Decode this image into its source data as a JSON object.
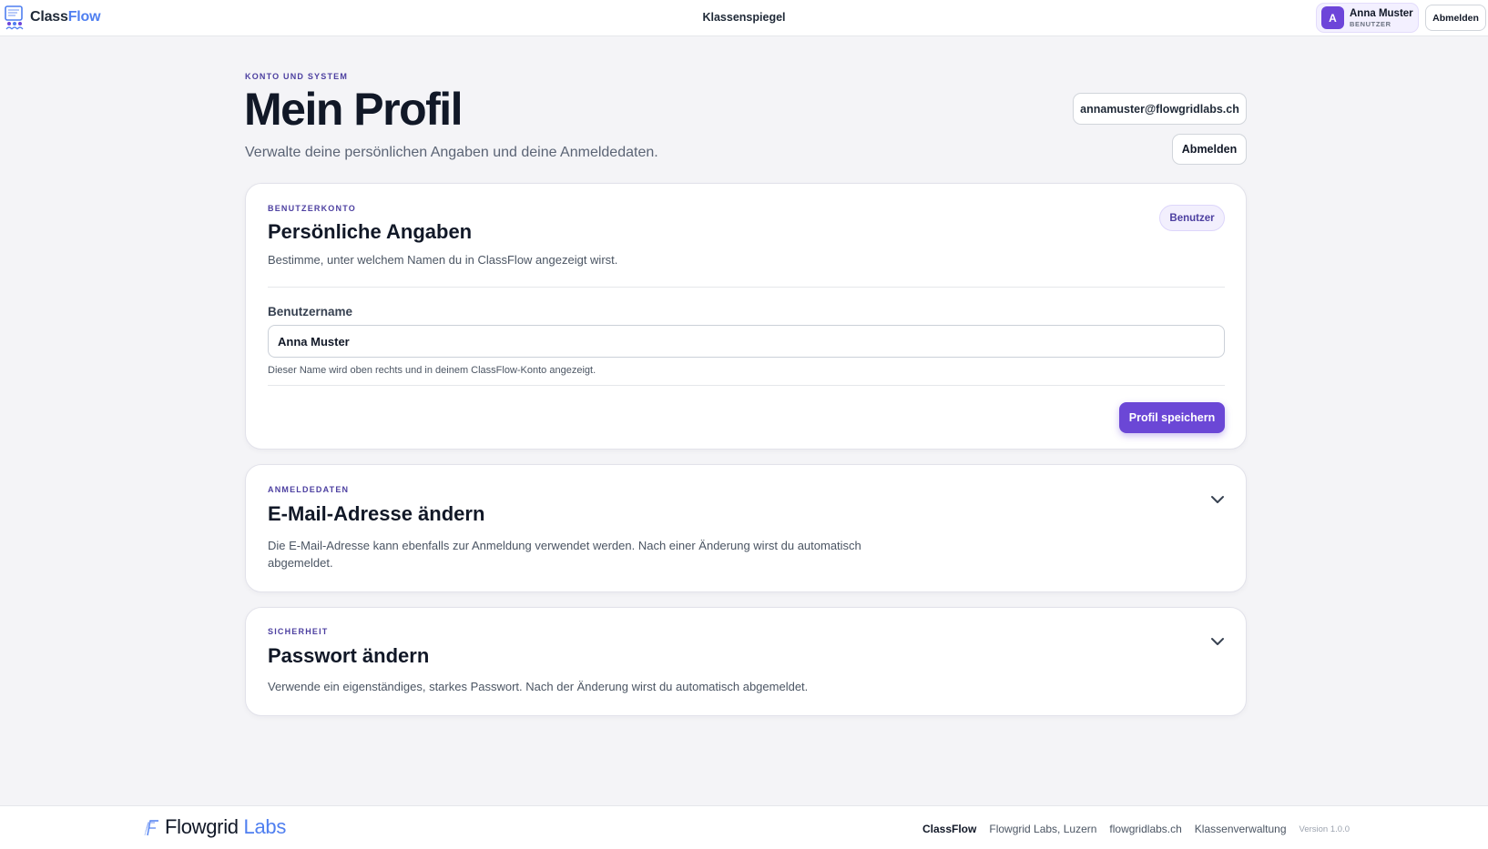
{
  "topbar": {
    "brand_plain": "Class",
    "brand_accent": "Flow",
    "nav_center": "Klassenspiegel",
    "user": {
      "initial": "A",
      "name": "Anna Muster",
      "role": "BENUTZER"
    },
    "logout_label": "Abmelden"
  },
  "page": {
    "eyebrow": "KONTO UND SYSTEM",
    "title": "Mein Profil",
    "subtitle": "Verwalte deine persönlichen Angaben und deine Anmeldedaten.",
    "email": "annamuster@flowgridlabs.ch",
    "logout_label": "Abmelden"
  },
  "profile_card": {
    "eyebrow": "BENUTZERKONTO",
    "title": "Persönliche Angaben",
    "description": "Bestimme, unter welchem Namen du in ClassFlow angezeigt wirst.",
    "role_badge": "Benutzer",
    "field_label": "Benutzername",
    "field_value": "Anna Muster",
    "field_help": "Dieser Name wird oben rechts und in deinem ClassFlow-Konto angezeigt.",
    "save_label": "Profil speichern"
  },
  "email_card": {
    "eyebrow": "ANMELDEDATEN",
    "title": "E-Mail-Adresse ändern",
    "description_line1": "Die E-Mail-Adresse kann ebenfalls zur Anmeldung verwendet werden. Nach einer Änderung wirst du automatisch",
    "description_line2": "abgemeldet."
  },
  "password_card": {
    "eyebrow": "SICHERHEIT",
    "title": "Passwort ändern",
    "description": "Verwende ein eigenständiges, starkes Passwort. Nach der Änderung wirst du automatisch abgemeldet."
  },
  "footer": {
    "brand_plain": "Flowgrid",
    "brand_accent": "Labs",
    "links": [
      "ClassFlow",
      "Flowgrid Labs, Luzern",
      "flowgridlabs.ch",
      "Klassenverwaltung"
    ],
    "version": "Version 1.0.0"
  },
  "colors": {
    "accent": "#6b47d6",
    "eyebrow": "#4c3fa0",
    "brand_blue": "#4f7ff0",
    "background": "#f4f4f7"
  },
  "icons": [
    "classflow-logo-icon",
    "chevron-down-icon",
    "flowgrid-logo-icon"
  ]
}
